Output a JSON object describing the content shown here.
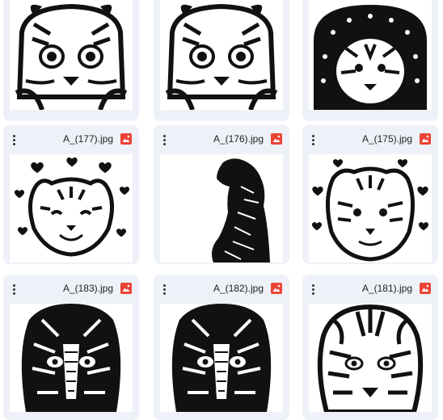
{
  "files": [
    {
      "name": "",
      "icon": "image-file-icon",
      "thumb": "tiger-cub-face-line-art"
    },
    {
      "name": "",
      "icon": "image-file-icon",
      "thumb": "tiger-cub-face-line-art"
    },
    {
      "name": "",
      "icon": "image-file-icon",
      "thumb": "tiger-with-hearts-arch"
    },
    {
      "name": "A_(177).jpg",
      "icon": "image-file-icon",
      "thumb": "smiling-tiger-with-hearts"
    },
    {
      "name": "A_(176).jpg",
      "icon": "image-file-icon",
      "thumb": "tiger-silhouette-side"
    },
    {
      "name": "A_(175).jpg",
      "icon": "image-file-icon",
      "thumb": "tiger-face-with-hearts"
    },
    {
      "name": "A_(183).jpg",
      "icon": "image-file-icon",
      "thumb": "ornate-tiger-face"
    },
    {
      "name": "A_(182).jpg",
      "icon": "image-file-icon",
      "thumb": "ornate-tiger-face"
    },
    {
      "name": "A_(181).jpg",
      "icon": "image-file-icon",
      "thumb": "tiger-face-line-art"
    }
  ],
  "colors": {
    "card_bg": "#eef1f7",
    "icon_red": "#ea4335"
  }
}
